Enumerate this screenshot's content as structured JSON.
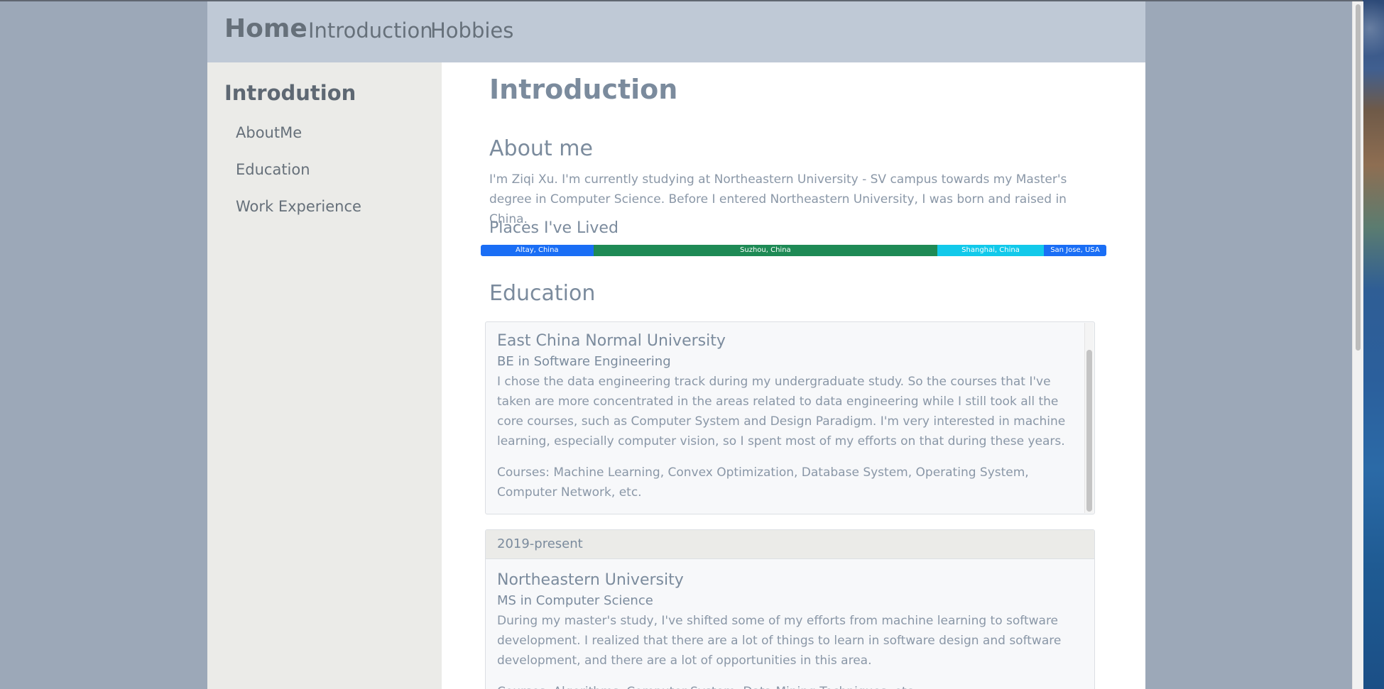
{
  "nav": {
    "brand": "Home",
    "links": [
      "Introduction",
      "Hobbies"
    ]
  },
  "sidebar": {
    "title": "Introdution",
    "items": [
      "AboutMe",
      "Education",
      "Work Experience"
    ]
  },
  "main": {
    "title": "Introduction",
    "about": {
      "heading": "About me",
      "text": "I'm Ziqi Xu. I'm currently studying at Northeastern University - SV campus towards my Master's degree in Computer Science. Before I entered Northeastern University, I was born and raised in China."
    },
    "places": {
      "heading": "Places I've Lived",
      "segments": [
        {
          "label": "Altay, China",
          "share": 18,
          "color": "#1a6ef5"
        },
        {
          "label": "Suzhou, China",
          "share": 55,
          "color": "#1e8a55"
        },
        {
          "label": "Shanghai, China",
          "share": 17,
          "color": "#12c9ea"
        },
        {
          "label": "San Jose, USA",
          "share": 10,
          "color": "#1a6ef5"
        }
      ]
    },
    "education": {
      "heading": "Education",
      "cards": [
        {
          "header": "",
          "university": "East China Normal University",
          "degree": "BE in Software Engineering",
          "description": "I chose the data engineering track during my undergraduate study. So the courses that I've taken are more concentrated in the areas related to data engineering while I still took all the core courses, such as Computer System and Design Paradigm. I'm very interested in machine learning, especially computer vision, so I spent most of my efforts on that during these years.",
          "courses": "Courses: Machine Learning, Convex Optimization, Database System, Operating System, Computer Network, etc."
        },
        {
          "header": "2019-present",
          "university": "Northeastern University",
          "degree": "MS in Computer Science",
          "description": "During my master's study, I've shifted some of my efforts from machine learning to software development. I realized that there are a lot of things to learn in software design and software development, and there are a lot of opportunities in this area.",
          "courses": "Courses: Algorithms, Computer System, Data Mining Techniques, etc."
        }
      ]
    }
  }
}
